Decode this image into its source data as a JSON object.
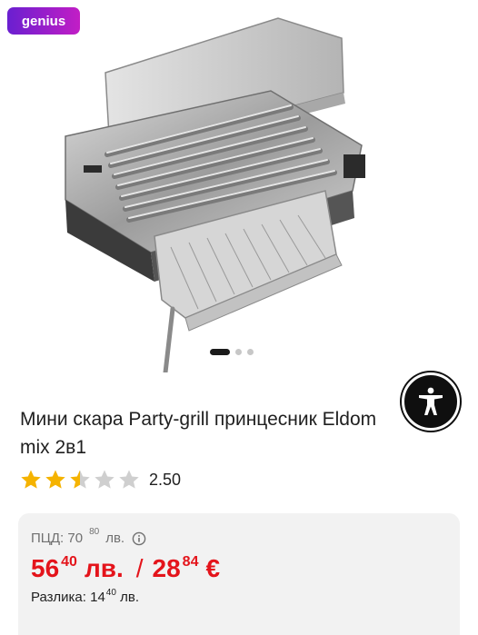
{
  "badge": {
    "label": "genius"
  },
  "product": {
    "title": "Мини скара Party-grill принцесник Eldom mix 2в1",
    "rating": 2.5,
    "rating_label": "2.50",
    "image_alt": "Мини скара Party-grill"
  },
  "carousel": {
    "count": 3,
    "active": 0
  },
  "pricing": {
    "rrp_label": "ПЦД:",
    "rrp_int": "70",
    "rrp_dec": "80",
    "rrp_currency": "лв.",
    "price_int": "56",
    "price_dec": "40",
    "price_currency": "лв.",
    "separator": "/",
    "eur_int": "28",
    "eur_dec": "84",
    "eur_currency": "€",
    "diff_label": "Разлика:",
    "diff_int": "14",
    "diff_dec": "40",
    "diff_currency": "лв."
  },
  "colors": {
    "badge_start": "#6a1fd0",
    "badge_end": "#c21ec5",
    "price": "#e4141b",
    "star": "#f5b301",
    "star_empty": "#cfcfcf"
  }
}
